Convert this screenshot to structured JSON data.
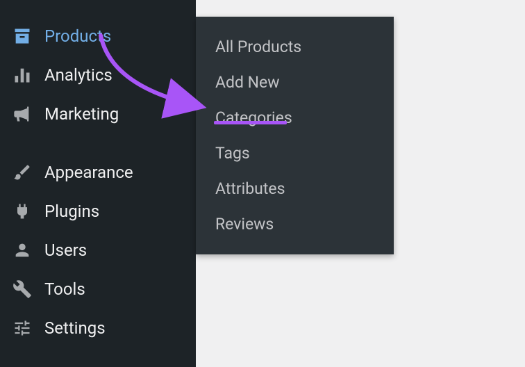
{
  "sidebar": {
    "items": [
      {
        "label": "Products",
        "icon": "products"
      },
      {
        "label": "Analytics",
        "icon": "analytics"
      },
      {
        "label": "Marketing",
        "icon": "marketing"
      },
      {
        "label": "Appearance",
        "icon": "appearance"
      },
      {
        "label": "Plugins",
        "icon": "plugins"
      },
      {
        "label": "Users",
        "icon": "users"
      },
      {
        "label": "Tools",
        "icon": "tools"
      },
      {
        "label": "Settings",
        "icon": "settings"
      }
    ]
  },
  "submenu": {
    "items": [
      {
        "label": "All Products"
      },
      {
        "label": "Add New"
      },
      {
        "label": "Categories"
      },
      {
        "label": "Tags"
      },
      {
        "label": "Attributes"
      },
      {
        "label": "Reviews"
      }
    ]
  },
  "annotation": {
    "color": "#a855f7",
    "highlighted": "Categories"
  }
}
